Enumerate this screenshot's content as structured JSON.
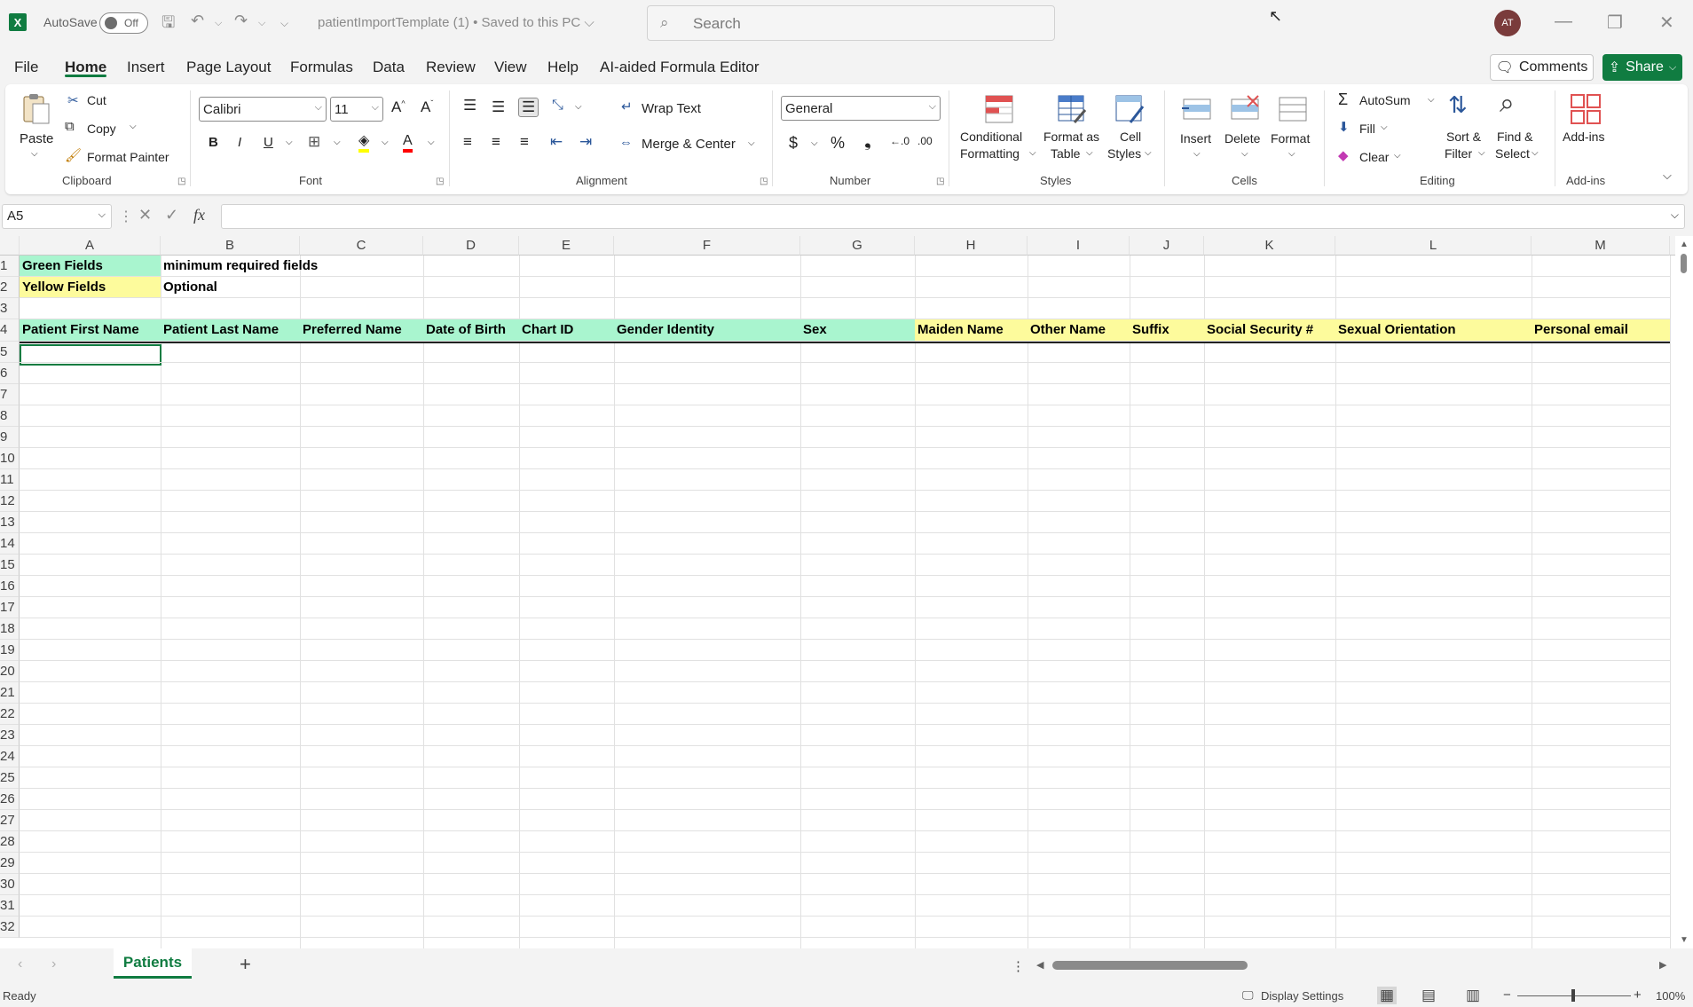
{
  "window": {
    "app_icon": "excel-icon",
    "autosave_label": "AutoSave",
    "autosave_state": "Off",
    "doc_title": "patientImportTemplate (1) • Saved to this PC ⌵",
    "search_placeholder": "Search",
    "avatar_initials": "AT"
  },
  "menu": {
    "items": [
      "File",
      "Home",
      "Insert",
      "Page Layout",
      "Formulas",
      "Data",
      "Review",
      "View",
      "Help",
      "AI-aided Formula Editor"
    ],
    "active": "Home",
    "comments_label": "Comments",
    "share_label": "Share"
  },
  "ribbon": {
    "clipboard": {
      "paste": "Paste",
      "cut": "Cut",
      "copy": "Copy",
      "format_painter": "Format Painter",
      "label": "Clipboard"
    },
    "font": {
      "name": "Calibri",
      "size": "11",
      "label": "Font",
      "bold": "B",
      "italic": "I",
      "underline": "U"
    },
    "alignment": {
      "wrap": "Wrap Text",
      "merge": "Merge & Center",
      "label": "Alignment"
    },
    "number": {
      "format": "General",
      "currency": "$",
      "percent": "%",
      "comma": "❟",
      "label": "Number"
    },
    "styles": {
      "conditional": "Conditional",
      "conditional2": "Formatting",
      "format_table": "Format as",
      "format_table2": "Table",
      "cell_styles": "Cell",
      "cell_styles2": "Styles",
      "label": "Styles"
    },
    "cells": {
      "insert": "Insert",
      "delete": "Delete",
      "format": "Format",
      "label": "Cells"
    },
    "editing": {
      "autosum": "AutoSum",
      "fill": "Fill",
      "clear": "Clear",
      "sort": "Sort &",
      "sort2": "Filter",
      "find": "Find &",
      "find2": "Select",
      "label": "Editing"
    },
    "addins": {
      "addins": "Add-ins",
      "label": "Add-ins"
    }
  },
  "formula_bar": {
    "name_box": "A5",
    "fx": "fx",
    "value": ""
  },
  "sheet": {
    "columns": [
      "A",
      "B",
      "C",
      "D",
      "E",
      "F",
      "G",
      "H",
      "I",
      "J",
      "K",
      "L",
      "M"
    ],
    "rows": [
      "1",
      "2",
      "3",
      "4",
      "5",
      "6",
      "7",
      "8",
      "9",
      "10",
      "11",
      "12",
      "13",
      "14",
      "15",
      "16",
      "17",
      "18",
      "19",
      "20",
      "21",
      "22",
      "23",
      "24",
      "25",
      "26",
      "27",
      "28",
      "29",
      "30",
      "31",
      "32"
    ],
    "legend": {
      "green_label": "Green Fields",
      "green_desc": "minimum required fields",
      "yellow_label": "Yellow Fields",
      "yellow_desc": "Optional"
    },
    "headers_green": [
      "Patient First Name",
      "Patient Last Name",
      "Preferred Name",
      "Date of Birth",
      "Chart ID",
      "Gender Identity",
      "Sex"
    ],
    "headers_yellow": [
      "Maiden Name",
      "Other Name",
      "Suffix",
      "Social Security #",
      "Sexual Orientation",
      "Personal email"
    ],
    "colors": {
      "green": "#a9f5cf",
      "yellow": "#fdfb9c",
      "accent": "#107c41"
    }
  },
  "tabs": {
    "sheet_name": "Patients",
    "add": "+"
  },
  "status": {
    "ready": "Ready",
    "display_settings": "Display Settings",
    "zoom": "100%"
  }
}
